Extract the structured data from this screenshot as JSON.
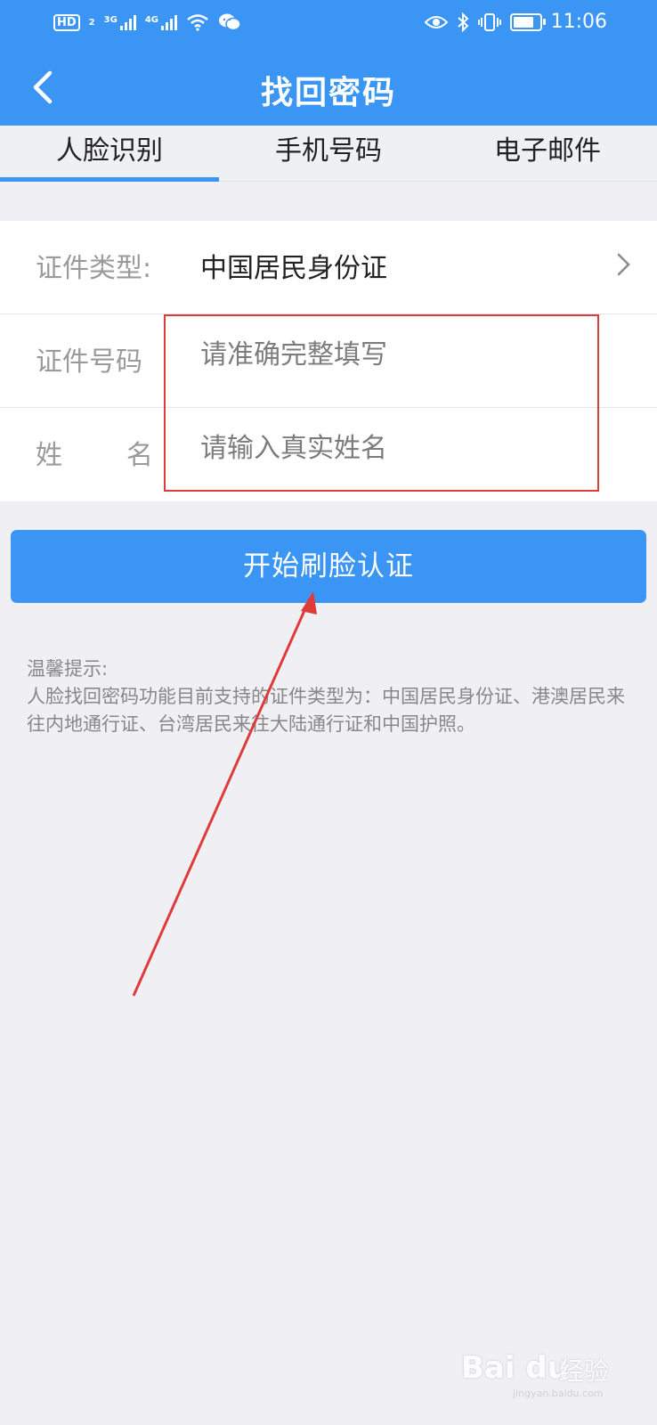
{
  "status_bar": {
    "hd_label": "HD",
    "hd_sub": "2",
    "signal1_label": "3G",
    "signal2_label": "4G",
    "time": "11:06",
    "battery_level": 0.8,
    "icons": [
      "hd-icon",
      "signal-icon",
      "wifi-icon",
      "wechat-icon",
      "eye-icon",
      "bluetooth-icon",
      "vibrate-icon",
      "battery-icon"
    ]
  },
  "nav": {
    "title": "找回密码",
    "back_icon": "back-chevron-icon"
  },
  "tabs": [
    {
      "label": "人脸识别",
      "active": true
    },
    {
      "label": "手机号码",
      "active": false
    },
    {
      "label": "电子邮件",
      "active": false
    }
  ],
  "form": {
    "id_type_label": "证件类型:",
    "id_type_value": "中国居民身份证",
    "id_number_label": "证件号码",
    "id_number_placeholder": "请准确完整填写",
    "name_label_char1": "姓",
    "name_label_char2": "名",
    "name_placeholder": "请输入真实姓名"
  },
  "button": {
    "label": "开始刷脸认证"
  },
  "tips": {
    "title": "温馨提示:",
    "body": "人脸找回密码功能目前支持的证件类型为：中国居民身份证、港澳居民来往内地通行证、台湾居民来往大陆通行证和中国护照。"
  },
  "watermark": {
    "logo": "Bai du",
    "text": "经验",
    "url": "jingyan.baidu.com"
  },
  "colors": {
    "primary": "#3b95f4",
    "background": "#efeff4",
    "annotation_red": "#e03b3b"
  }
}
